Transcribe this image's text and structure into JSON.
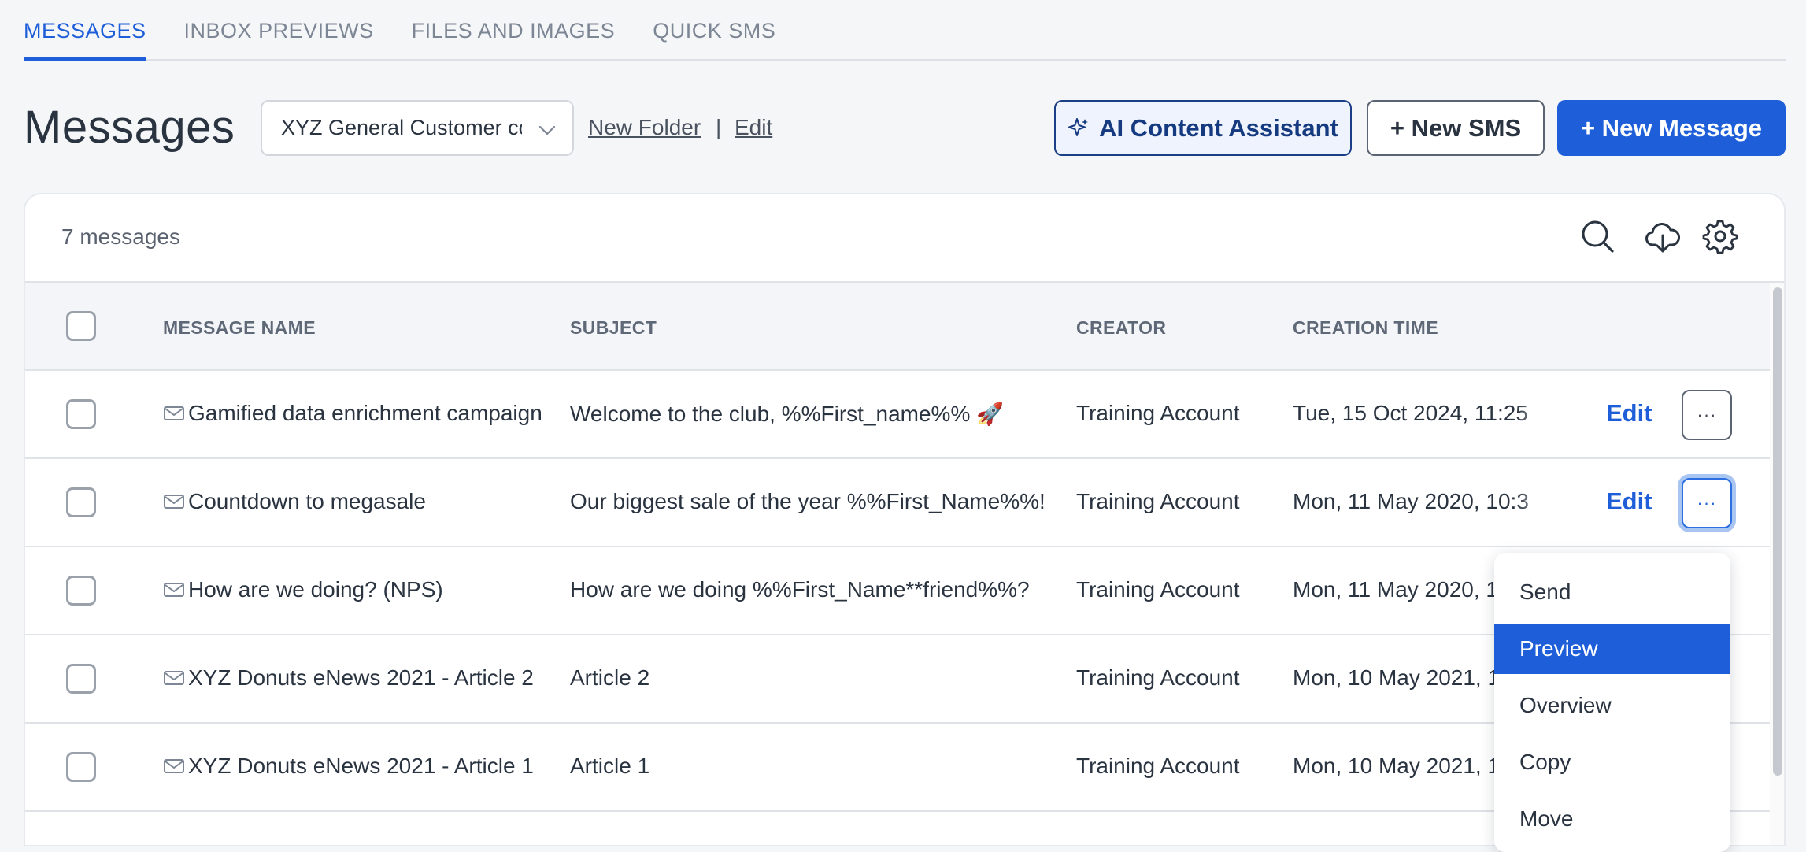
{
  "tabs": [
    {
      "label": "MESSAGES"
    },
    {
      "label": "INBOX PREVIEWS"
    },
    {
      "label": "FILES AND IMAGES"
    },
    {
      "label": "QUICK SMS"
    }
  ],
  "header": {
    "title": "Messages",
    "folder_value": "XYZ General Customer comms",
    "new_folder": "New Folder",
    "separator": "|",
    "edit_folder": "Edit",
    "ai_button": "AI Content Assistant",
    "new_sms_button": "+ New SMS",
    "new_message_button": "+ New Message"
  },
  "card": {
    "count": "7 messages"
  },
  "table": {
    "columns": {
      "name": "MESSAGE NAME",
      "subject": "SUBJECT",
      "creator": "CREATOR",
      "time": "CREATION TIME"
    },
    "edit_label": "Edit",
    "more_label": "···",
    "rows": [
      {
        "name": "Gamified data enrichment campaign",
        "subject": "Welcome to the club, %%First_name%% 🚀",
        "creator": "Training Account",
        "time": "Tue, 15 Oct 2024, 11:25"
      },
      {
        "name": "Countdown to megasale",
        "subject": "Our biggest sale of the year %%First_Name%%!",
        "creator": "Training Account",
        "time": "Mon, 11 May 2020, 10:3"
      },
      {
        "name": "How are we doing? (NPS)",
        "subject": "How are we doing %%First_Name**friend%%?",
        "creator": "Training Account",
        "time": "Mon, 11 May 2020, 1"
      },
      {
        "name": "XYZ Donuts eNews 2021 - Article 2",
        "subject": "Article 2",
        "creator": "Training Account",
        "time": "Mon, 10 May 2021, 1"
      },
      {
        "name": "XYZ Donuts eNews 2021 - Article 1",
        "subject": "Article 1",
        "creator": "Training Account",
        "time": "Mon, 10 May 2021, 1"
      }
    ]
  },
  "menu": {
    "items": [
      {
        "label": "Send"
      },
      {
        "label": "Preview"
      },
      {
        "label": "Overview"
      },
      {
        "label": "Copy"
      },
      {
        "label": "Move"
      }
    ]
  },
  "colors": {
    "accent": "#1e5fd9",
    "ai_border": "#1b3f86",
    "background": "#f5f6f8"
  },
  "icons": [
    "sparkle-icon",
    "chevron-down-icon",
    "search-icon",
    "cloud-download-icon",
    "gear-icon",
    "envelope-icon"
  ]
}
